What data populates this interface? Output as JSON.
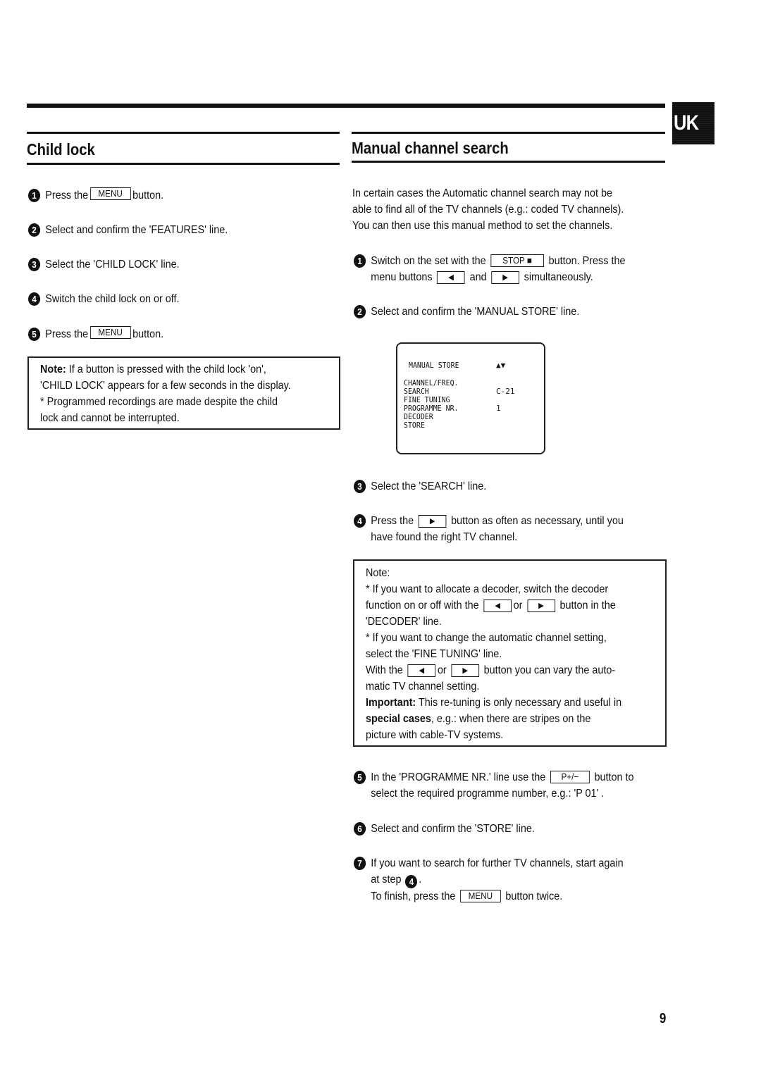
{
  "language_badge": "UK",
  "page_number": "9",
  "child_lock": {
    "title": "Child lock",
    "steps": [
      {
        "num": "1",
        "pre": "Press the",
        "key": "MENU",
        "post": "button."
      },
      {
        "num": "2",
        "text": "Select and confirm the 'FEATURES' line."
      },
      {
        "num": "3",
        "text": "Select the 'CHILD LOCK' line."
      },
      {
        "num": "4",
        "text": "Switch the child lock on or off."
      },
      {
        "num": "5",
        "pre": "Press the",
        "key": "MENU",
        "post": "button."
      }
    ],
    "note": {
      "label": "Note:",
      "line1": " If a button is pressed with the child lock 'on',",
      "line2": "'CHILD LOCK' appears for a few seconds in the display.",
      "line3": "* Programmed recordings are made despite the child",
      "line4": "lock and cannot be interrupted."
    }
  },
  "manual_search": {
    "title": "Manual channel search",
    "intro": [
      "In certain cases the Automatic channel search may not be",
      "able to find all of the TV channels (e.g.: coded TV channels).",
      "You can then use this manual method to set the channels."
    ],
    "step1": {
      "num": "1",
      "pre": "Switch on the set with the",
      "key": "STOP ■",
      "post": "button. Press the",
      "line2_pre": "menu buttons",
      "key_left": "◀",
      "mid": "and",
      "key_right": "▶",
      "line2_post": "simultaneously."
    },
    "step2": {
      "num": "2",
      "text": "Select and confirm the 'MANUAL STORE' line."
    },
    "osd": {
      "title": "MANUAL STORE",
      "arrows": "▲▼",
      "rows": [
        {
          "label": "CHANNEL/FREQ.",
          "value": ""
        },
        {
          "label": "SEARCH",
          "value": "C-21"
        },
        {
          "label": "FINE TUNING",
          "value": ""
        },
        {
          "label": "PROGRAMME NR.",
          "value": "1"
        },
        {
          "label": "DECODER",
          "value": ""
        },
        {
          "label": "STORE",
          "value": ""
        }
      ]
    },
    "step3": {
      "num": "3",
      "text": "Select the 'SEARCH' line."
    },
    "step4": {
      "num": "4",
      "pre": "Press the",
      "key": "▶",
      "post": "button as often as necessary, until you",
      "line2": "have found the right TV channel."
    },
    "note": {
      "heading": "Note:",
      "l1": "* If you want to allocate a decoder, switch the decoder",
      "l2_pre": "function on or off with the",
      "key_left": "◀",
      "or": "or",
      "key_right": "▶",
      "l2_post": "button in the",
      "l3": "'DECODER' line.",
      "l4": "* If you want to change the automatic channel setting,",
      "l5": "select the 'FINE TUNING' line.",
      "l6_pre": "With the",
      "l6_post": "button you can vary the auto-",
      "l7": "matic TV channel setting.",
      "important_label": "Important:",
      "l8": " This re-tuning is only necessary and useful in",
      "special_label": "special cases",
      "l9": ", e.g.: when there are stripes on the",
      "l10": "picture with cable-TV systems."
    },
    "step5": {
      "num": "5",
      "pre": "In the 'PROGRAMME NR.' line use the",
      "key": "P+/−",
      "post": "button to",
      "line2": "select the required programme number, e.g.: 'P 01' ."
    },
    "step6": {
      "num": "6",
      "text": "Select and confirm the 'STORE' line."
    },
    "step7": {
      "num": "7",
      "line1": "If you want to search for further TV channels, start again",
      "line2_pre": "at step",
      "ref": "4",
      "line2_post": ".",
      "line3_pre": "To finish, press the",
      "key": "MENU",
      "line3_post": "button twice."
    }
  }
}
